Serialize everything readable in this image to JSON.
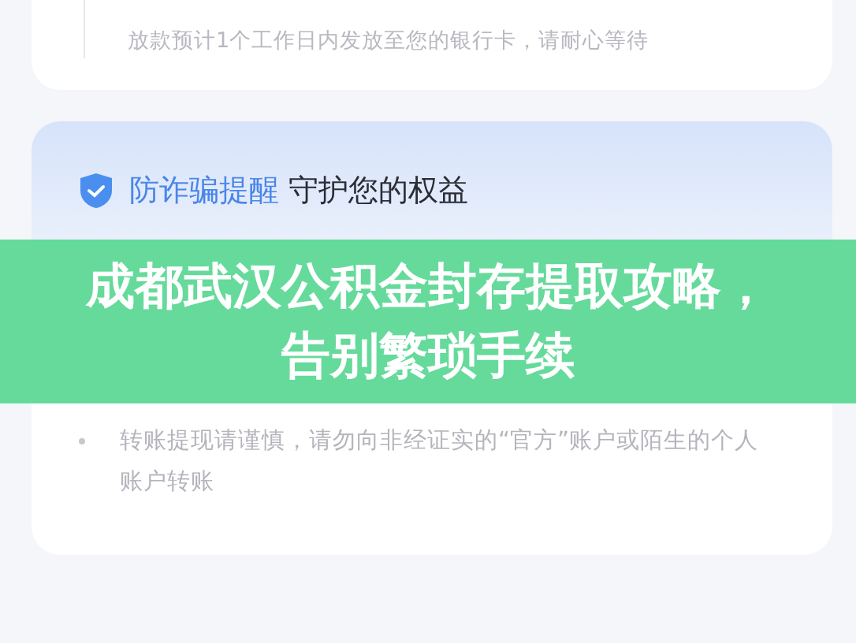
{
  "progress_card": {
    "description": "放款预计1个工作日内发放至您的银行卡，请耐心等待"
  },
  "safety_card": {
    "title_highlight": "防诈骗提醒",
    "title_rest": "守护您的权益",
    "tips": [
      "转账提现请谨慎，请勿向非经证实的“官方”账户或陌生的个人账户转账"
    ]
  },
  "banner": {
    "title": "成都武汉公积金封存提取攻略，告别繁琐手续"
  }
}
